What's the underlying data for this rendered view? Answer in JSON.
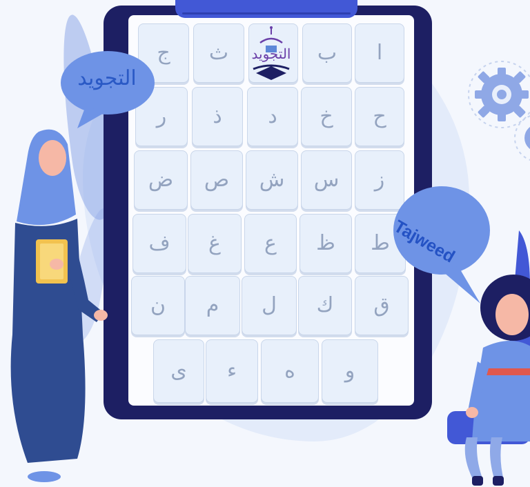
{
  "rows": [
    [
      "ج",
      "ث",
      "",
      "ب",
      "ا"
    ],
    [
      "ر",
      "ذ",
      "د",
      "خ",
      "ح"
    ],
    [
      "ض",
      "ص",
      "ش",
      "س",
      "ز"
    ],
    [
      "ف",
      "غ",
      "ع",
      "ظ",
      "ط"
    ],
    [
      "ن",
      "م",
      "ل",
      "ك",
      "ق"
    ],
    [
      "ى",
      "ء",
      "ه",
      "و"
    ]
  ],
  "logo_text": "التجويد",
  "bubble_left_text": "التجويد",
  "bubble_right_text": "Tajweed",
  "colors": {
    "clipboard": "#1d1f63",
    "clip": "#4258d6",
    "key_bg": "#e8f0fb",
    "letter": "#93a3bf",
    "bubble": "#6e93e6",
    "accent_blue": "#2452c4",
    "logo_purple": "#6a3fa8"
  },
  "icons": [
    "gear-icon",
    "book-icon"
  ]
}
